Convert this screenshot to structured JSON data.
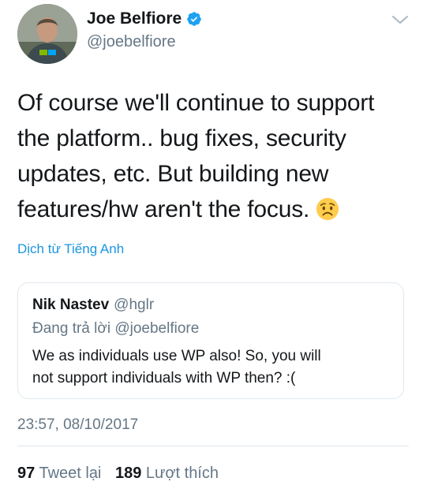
{
  "author": {
    "display_name": "Joe Belfiore",
    "handle": "@joebelfiore",
    "verified": true
  },
  "tweet": {
    "text": "Of course we'll continue to support\nthe platform.. bug fixes, security\nupdates, etc. But building new\nfeatures/hw aren't the focus.",
    "emoji": "worried-face",
    "translate_label": "Dịch từ Tiếng Anh"
  },
  "quoted": {
    "name": "Nik Nastev",
    "handle": "@hglr",
    "reply_prefix": "Đang trả lời",
    "reply_to": "@joebelfiore",
    "text": "We as individuals use WP also! So, you will\nnot support individuals with WP then? :("
  },
  "timestamp": "23:57, 08/10/2017",
  "stats": {
    "retweets_count": "97",
    "retweets_label": "Tweet lại",
    "likes_count": "189",
    "likes_label": "Lượt thích"
  },
  "colors": {
    "link": "#1b95e0",
    "secondary_text": "#657786",
    "primary_text": "#14171a",
    "border": "#e1e8ed"
  }
}
